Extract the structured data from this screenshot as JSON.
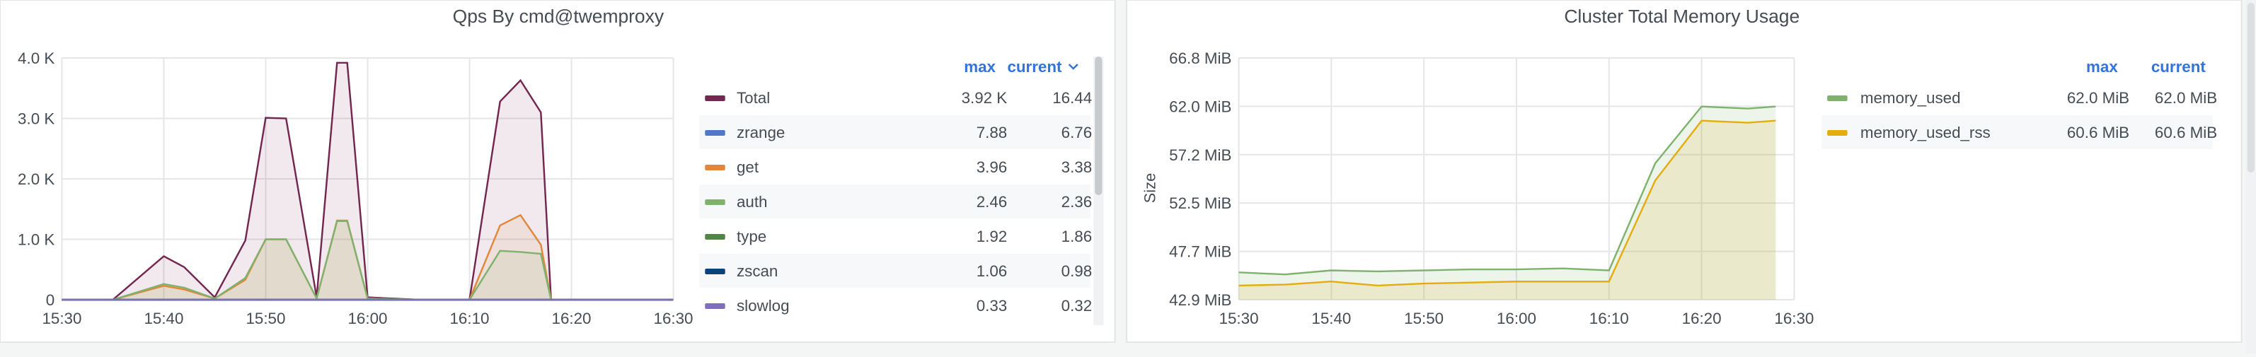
{
  "colors": {
    "total": "#73264f",
    "zrange": "#5277c9",
    "get": "#e0873c",
    "auth": "#7eb26d",
    "type": "#508642",
    "zscan": "#0a437c",
    "slowlog": "#806eb7",
    "memory_used": "#7eb26d",
    "memory_used_rss": "#e5ac0e",
    "link": "#3274d9",
    "grid": "#e4e6e8"
  },
  "panels": {
    "left": {
      "title": "Qps By cmd@twemproxy",
      "legend_header": {
        "max": "max",
        "current": "current"
      },
      "current_sorted_icon": "chevron-down-icon"
    },
    "right": {
      "title": "Cluster Total Memory Usage",
      "legend_header": {
        "max": "max",
        "current": "current"
      }
    }
  },
  "chart_data": [
    {
      "type": "line",
      "title": "Qps By cmd@twemproxy",
      "xlabel": "",
      "ylabel": "",
      "x": [
        "15:30",
        "15:35",
        "15:40",
        "15:42",
        "15:45",
        "15:48",
        "15:50",
        "15:52",
        "15:55",
        "15:57",
        "15:58",
        "16:00",
        "16:05",
        "16:10",
        "16:13",
        "16:15",
        "16:17",
        "16:18",
        "16:20",
        "16:25",
        "16:30"
      ],
      "x_ticks": [
        "15:30",
        "15:40",
        "15:50",
        "16:00",
        "16:10",
        "16:20",
        "16:30"
      ],
      "y_ticks": [
        "0",
        "1.0 K",
        "2.0 K",
        "3.0 K",
        "4.0 K"
      ],
      "ylim": [
        0,
        4000
      ],
      "grid": true,
      "legend_position": "right",
      "series": [
        {
          "name": "Total",
          "max": "3.92 K",
          "current": "16.44",
          "values": [
            0,
            0,
            720,
            540,
            40,
            980,
            3010,
            3000,
            40,
            3920,
            3920,
            40,
            0,
            0,
            3280,
            3630,
            3100,
            0,
            0,
            0,
            0
          ]
        },
        {
          "name": "zrange",
          "max": "7.88",
          "current": "6.76",
          "values": [
            0,
            0,
            0,
            0,
            0,
            0,
            0,
            0,
            0,
            0,
            0,
            0,
            0,
            0,
            0,
            0,
            0,
            0,
            0,
            0,
            0
          ]
        },
        {
          "name": "get",
          "max": "3.96",
          "current": "3.38",
          "values": [
            0,
            0,
            230,
            170,
            20,
            330,
            1000,
            1000,
            20,
            1310,
            1310,
            20,
            0,
            0,
            1230,
            1400,
            910,
            0,
            0,
            0,
            0
          ]
        },
        {
          "name": "auth",
          "max": "2.46",
          "current": "2.36",
          "values": [
            0,
            0,
            260,
            200,
            20,
            360,
            1000,
            1000,
            20,
            1300,
            1300,
            20,
            0,
            0,
            810,
            790,
            760,
            0,
            0,
            0,
            0
          ]
        },
        {
          "name": "type",
          "max": "1.92",
          "current": "1.86",
          "values": [
            0,
            0,
            0,
            0,
            0,
            0,
            0,
            0,
            0,
            0,
            0,
            0,
            0,
            0,
            0,
            0,
            0,
            0,
            0,
            0,
            0
          ]
        },
        {
          "name": "zscan",
          "max": "1.06",
          "current": "0.98",
          "values": [
            0,
            0,
            0,
            0,
            0,
            0,
            0,
            0,
            0,
            0,
            0,
            0,
            0,
            0,
            0,
            0,
            0,
            0,
            0,
            0,
            0
          ]
        },
        {
          "name": "slowlog",
          "max": "0.33",
          "current": "0.32",
          "values": [
            0,
            0,
            0,
            0,
            0,
            0,
            0,
            0,
            0,
            0,
            0,
            0,
            0,
            0,
            0,
            0,
            0,
            0,
            0,
            0,
            0
          ]
        }
      ]
    },
    {
      "type": "area",
      "title": "Cluster Total Memory Usage",
      "xlabel": "",
      "ylabel": "Size",
      "x": [
        "15:30",
        "15:35",
        "15:40",
        "15:45",
        "15:50",
        "15:55",
        "16:00",
        "16:05",
        "16:10",
        "16:15",
        "16:20",
        "16:25",
        "16:28"
      ],
      "x_ticks": [
        "15:30",
        "15:40",
        "15:50",
        "16:00",
        "16:10",
        "16:20",
        "16:30"
      ],
      "y_ticks": [
        "42.9 MiB",
        "47.7 MiB",
        "52.5 MiB",
        "57.2 MiB",
        "62.0 MiB",
        "66.8 MiB"
      ],
      "ylim": [
        42.9,
        66.8
      ],
      "grid": true,
      "legend_position": "right",
      "series": [
        {
          "name": "memory_used",
          "max": "62.0 MiB",
          "current": "62.0 MiB",
          "values": [
            45.6,
            45.4,
            45.8,
            45.7,
            45.8,
            45.9,
            45.9,
            46.0,
            45.8,
            56.4,
            62.0,
            61.8,
            62.0
          ]
        },
        {
          "name": "memory_used_rss",
          "max": "60.6 MiB",
          "current": "60.6 MiB",
          "values": [
            44.3,
            44.4,
            44.7,
            44.3,
            44.5,
            44.6,
            44.7,
            44.7,
            44.7,
            54.7,
            60.6,
            60.4,
            60.6
          ]
        }
      ]
    }
  ]
}
